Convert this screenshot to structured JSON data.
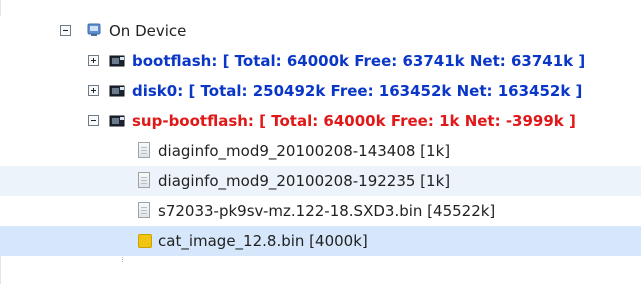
{
  "tree": {
    "root": {
      "label": "On Device",
      "icon": "device-icon"
    },
    "items": [
      {
        "label": "bootflash: [ Total: 64000k Free: 63741k Net: 63741k ]",
        "style": "blue",
        "expanded": false,
        "icon": "storage-chip-icon"
      },
      {
        "label": "disk0: [ Total: 250492k Free: 163452k Net: 163452k ]",
        "style": "blue",
        "expanded": false,
        "icon": "storage-chip-icon"
      },
      {
        "label": "sup-bootflash: [ Total: 64000k Free: 1k Net: -3999k ]",
        "style": "red",
        "expanded": true,
        "icon": "storage-chip-icon",
        "children": [
          {
            "label": "diaginfo_mod9_20100208-143408 [1k]",
            "icon": "file-icon"
          },
          {
            "label": "diaginfo_mod9_20100208-192235 [1k]",
            "icon": "file-icon"
          },
          {
            "label": "s72033-pk9sv-mz.122-18.SXD3.bin [45522k]",
            "icon": "file-icon"
          },
          {
            "label": "cat_image_12.8.bin [4000k]",
            "icon": "image-file-icon"
          }
        ]
      }
    ]
  },
  "colors": {
    "blue_text": "#0a37c8",
    "red_text": "#e01818",
    "alt_row": "#edf3fa",
    "selected_row": "#d6e7fb",
    "file_yellow": "#f1c40f"
  }
}
